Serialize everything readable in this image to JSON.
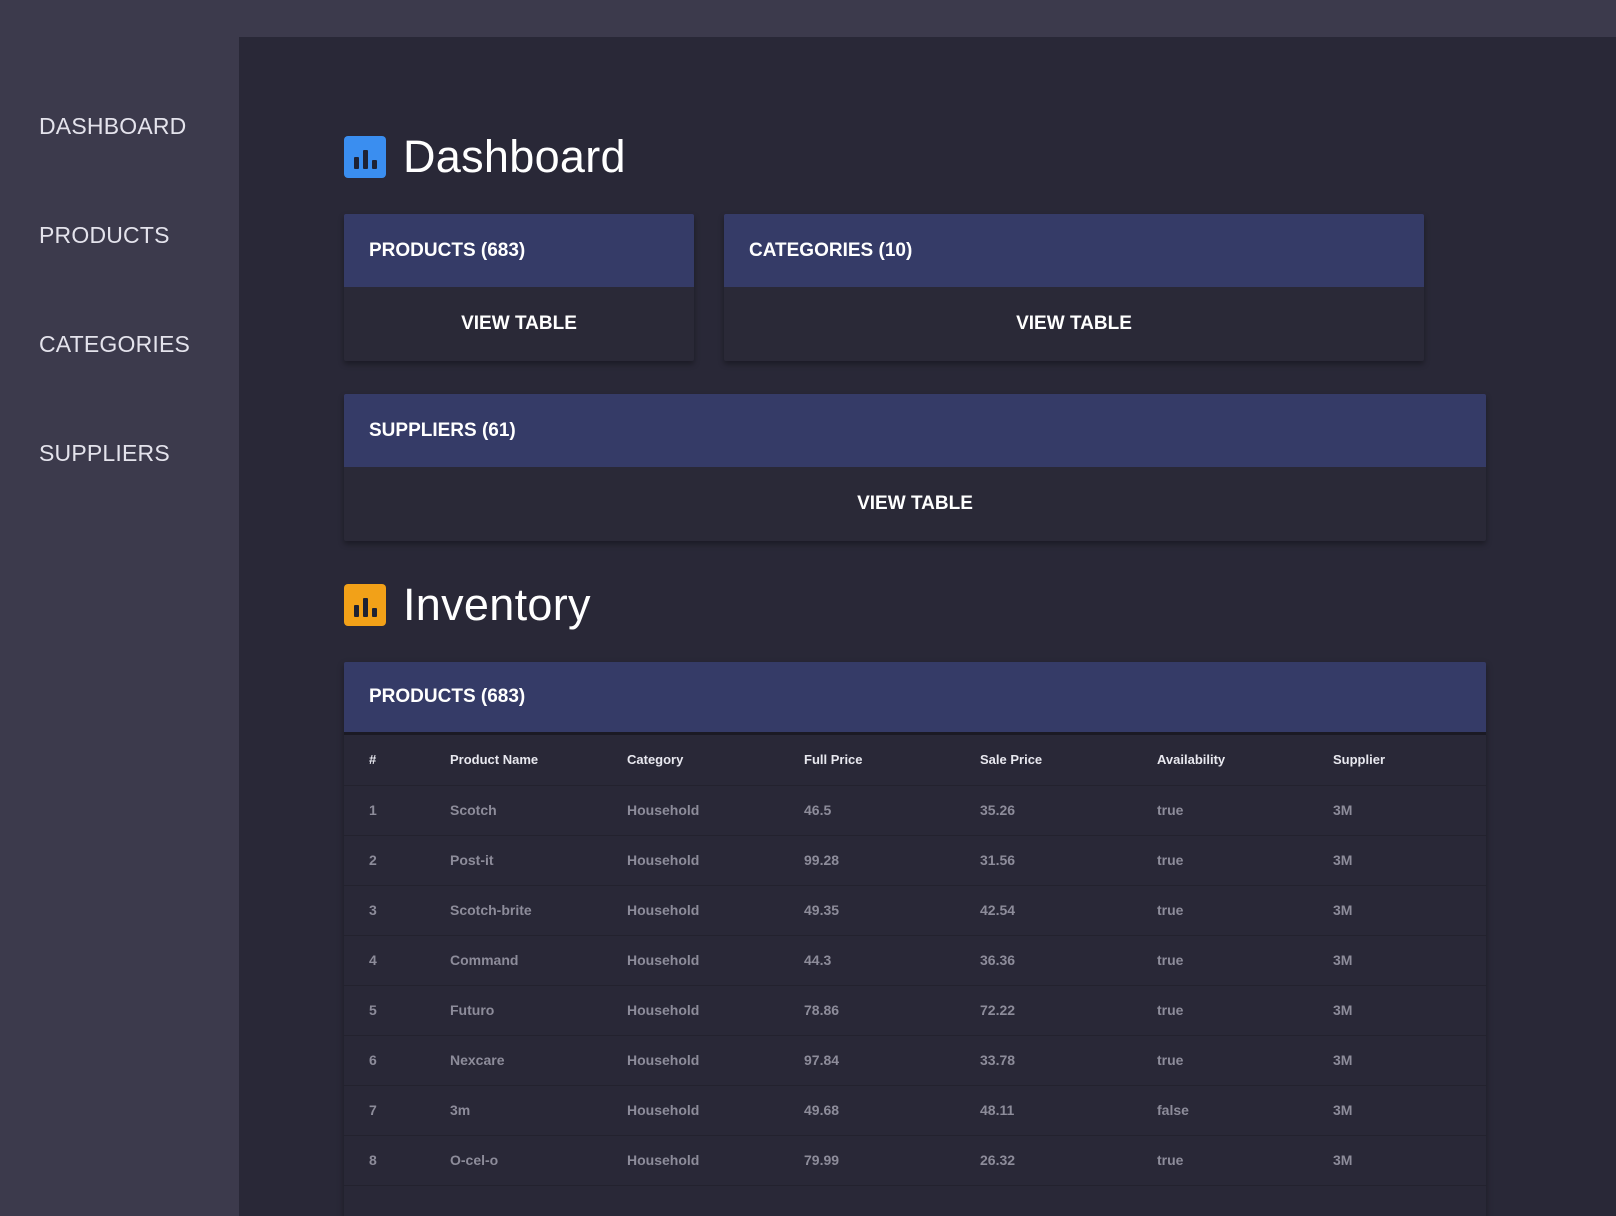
{
  "colors": {
    "sidebar_bg": "#3c3a4c",
    "main_bg": "#292837",
    "card_header_bg": "#353b67",
    "dashboard_icon": "#3a8ef0",
    "inventory_icon": "#f2a118",
    "accent_blue": "#2f8fe6"
  },
  "sidebar": {
    "items": [
      {
        "label": "DASHBOARD"
      },
      {
        "label": "PRODUCTS"
      },
      {
        "label": "CATEGORIES"
      },
      {
        "label": "SUPPLIERS"
      }
    ]
  },
  "dashboard": {
    "title": "Dashboard",
    "icon": "bar-chart-icon",
    "cards": [
      {
        "title": "PRODUCTS (683)",
        "action": "VIEW TABLE"
      },
      {
        "title": "CATEGORIES (10)",
        "action": "VIEW TABLE"
      },
      {
        "title": "SUPPLIERS (61)",
        "action": "VIEW TABLE"
      }
    ]
  },
  "inventory": {
    "title": "Inventory",
    "icon": "bar-chart-icon",
    "table_title": "PRODUCTS (683)",
    "columns": [
      "#",
      "Product Name",
      "Category",
      "Full Price",
      "Sale Price",
      "Availability",
      "Supplier"
    ],
    "rows": [
      [
        "1",
        "Scotch",
        "Household",
        "46.5",
        "35.26",
        "true",
        "3M"
      ],
      [
        "2",
        "Post-it",
        "Household",
        "99.28",
        "31.56",
        "true",
        "3M"
      ],
      [
        "3",
        "Scotch-brite",
        "Household",
        "49.35",
        "42.54",
        "true",
        "3M"
      ],
      [
        "4",
        "Command",
        "Household",
        "44.3",
        "36.36",
        "true",
        "3M"
      ],
      [
        "5",
        "Futuro",
        "Household",
        "78.86",
        "72.22",
        "true",
        "3M"
      ],
      [
        "6",
        "Nexcare",
        "Household",
        "97.84",
        "33.78",
        "true",
        "3M"
      ],
      [
        "7",
        "3m",
        "Household",
        "49.68",
        "48.11",
        "false",
        "3M"
      ],
      [
        "8",
        "O-cel-o",
        "Household",
        "79.99",
        "26.32",
        "true",
        "3M"
      ]
    ]
  }
}
